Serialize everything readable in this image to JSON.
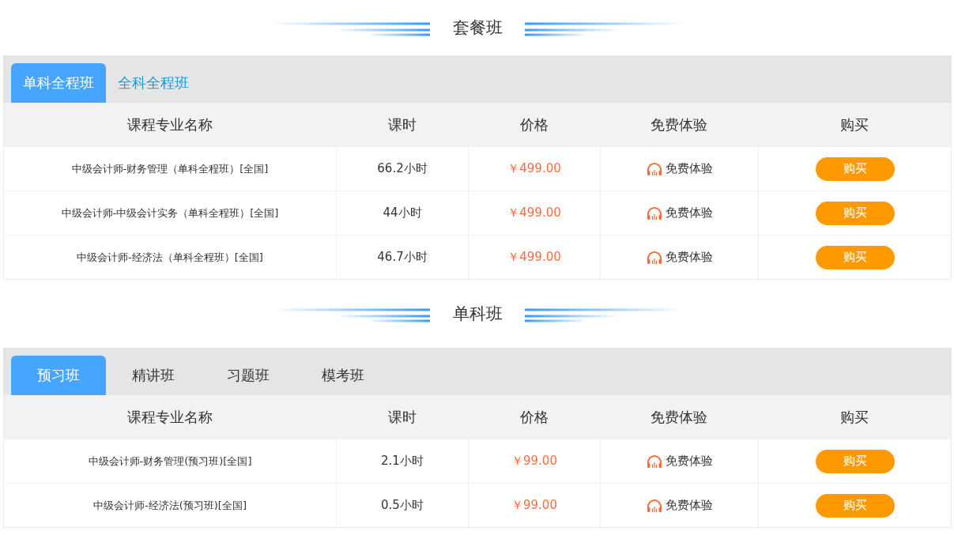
{
  "sections": [
    {
      "title": "套餐班",
      "kind": "package",
      "tabs": [
        {
          "label": "单科全程班",
          "selected": true
        },
        {
          "label": "全科全程班",
          "selected": false
        }
      ],
      "columns": [
        "课程专业名称",
        "课时",
        "价格",
        "免费体验",
        "购买"
      ],
      "rows": [
        {
          "name": "中级会计师-财务管理（单科全程班）[全国]",
          "hours": "66.2小时",
          "price": "￥499.00",
          "trial": "免费体验",
          "buy": "购买"
        },
        {
          "name": "中级会计师-中级会计实务（单科全程班）[全国]",
          "hours": "44小时",
          "price": "￥499.00",
          "trial": "免费体验",
          "buy": "购买"
        },
        {
          "name": "中级会计师-经济法（单科全程班）[全国]",
          "hours": "46.7小时",
          "price": "￥499.00",
          "trial": "免费体验",
          "buy": "购买"
        }
      ]
    },
    {
      "title": "单科班",
      "kind": "single",
      "tabs": [
        {
          "label": "预习班",
          "selected": true
        },
        {
          "label": "精讲班",
          "selected": false
        },
        {
          "label": "习题班",
          "selected": false
        },
        {
          "label": "模考班",
          "selected": false
        }
      ],
      "columns": [
        "课程专业名称",
        "课时",
        "价格",
        "免费体验",
        "购买"
      ],
      "rows": [
        {
          "name": "中级会计师-财务管理(预习班)[全国]",
          "hours": "2.1小时",
          "price": "￥99.00",
          "trial": "免费体验",
          "buy": "购买"
        },
        {
          "name": "中级会计师-经济法(预习班)[全国]",
          "hours": "0.5小时",
          "price": "￥99.00",
          "trial": "免费体验",
          "buy": "购买"
        }
      ]
    }
  ]
}
